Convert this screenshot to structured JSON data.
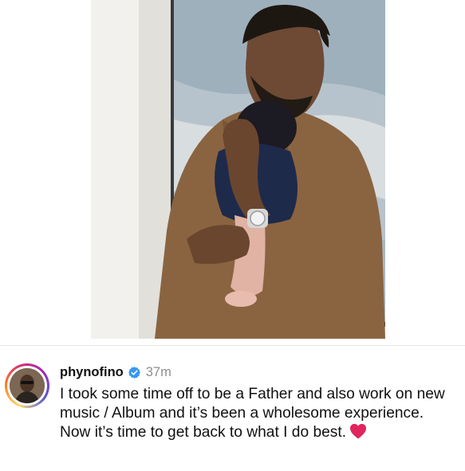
{
  "post": {
    "username": "phynofino",
    "timestamp": "37m",
    "caption": "I took some time off to be a Father and also work on new music / Album and it’s been a wholesome experience. Now it’s time to get back to what I do best.",
    "emoji": "heart-emoji"
  },
  "icons": {
    "verified": "verified-badge-icon",
    "heart": "red-heart-icon"
  },
  "colors": {
    "verified_blue": "#3897f0",
    "timestamp_gray": "#8e8e8e",
    "heart_red": "#e0245e"
  }
}
